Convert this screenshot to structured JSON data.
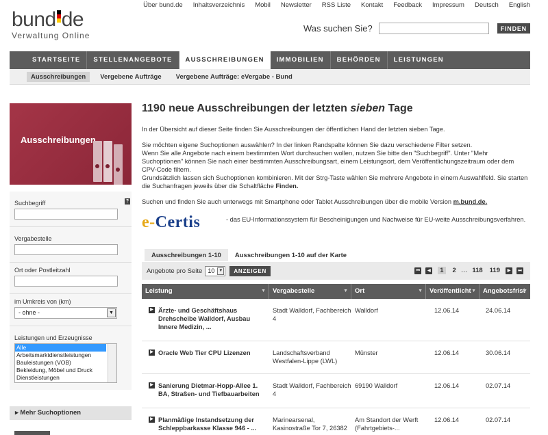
{
  "toplinks": [
    "Über bund.de",
    "Inhaltsverzeichnis",
    "Mobil",
    "Newsletter",
    "RSS Liste",
    "Kontakt",
    "Feedback",
    "Impressum",
    "Deutsch",
    "English"
  ],
  "logo": {
    "left": "bund",
    "right": "de",
    "sub": "Verwaltung Online"
  },
  "search": {
    "label": "Was suchen Sie?",
    "button": "FINDEN"
  },
  "mainnav": [
    "STARTSEITE",
    "STELLENANGEBOTE",
    "AUSSCHREIBUNGEN",
    "IMMOBILIEN",
    "BEHÖRDEN",
    "LEISTUNGEN"
  ],
  "subnav": [
    "Ausschreibungen",
    "Vergebene Aufträge",
    "Vergebene Aufträge: eVergabe - Bund"
  ],
  "sidebar": {
    "banner_title": "Ausschreibungen",
    "help": "?",
    "suchbegriff": "Suchbegriff",
    "vergabestelle": "Vergabestelle",
    "ort": "Ort oder Postleitzahl",
    "umkreis": "im Umkreis von (km)",
    "umkreis_value": "- ohne -",
    "leistungen": "Leistungen und Erzeugnisse",
    "leistungen_options": [
      "Alle",
      "Arbeitsmarktdienstleistungen",
      "Bauleistungen (VOB)",
      "Bekleidung, Möbel und Druck",
      "Dienstleistungen"
    ],
    "more": "Mehr Suchoptionen"
  },
  "main": {
    "title_pre": "1190 neue Ausschreibungen der letzten ",
    "title_em": "sieben",
    "title_post": " Tage",
    "p1": "In der Übersicht auf dieser Seite finden Sie Ausschreibungen der öffentlichen Hand der letzten sieben Tage.",
    "p2a": "Sie möchten eigene Suchoptionen auswählen? In der linken Randspalte können Sie dazu verschiedene Filter setzen.",
    "p2b": "Wenn Sie alle Angebote nach einem bestimmten Wort durchsuchen wollen, nutzen Sie bitte den \"Suchbegriff\". Unter \"Mehr Suchoptionen\" können Sie nach einer bestimmten Ausschreibungsart, einem Leistungsort, dem Veröffentlichungszeitraum oder dem CPV-Code filtern.",
    "p2c": "Grundsätzlich lassen sich Suchoptionen kombinieren. Mit der Strg-Taste wählen Sie mehrere Angebote in einem Auswahlfeld. Sie starten die Suchanfragen jeweils über die Schaltfläche ",
    "p2c_bold": "Finden.",
    "p3": "Suchen und finden Sie auch unterwegs mit Smartphone oder Tablet Ausschreibungen über die mobile Version ",
    "p3_link": "m.bund.de.",
    "ecertis_logo_e": "e-",
    "ecertis_logo_rest": "Certis",
    "ecertis_text": "- das EU-Informationssystem für Bescheinigungen und Nachweise für EU-weite Ausschreibungsverfahren."
  },
  "tabs": [
    "Ausschreibungen 1-10",
    "Ausschreibungen 1-10 auf der Karte"
  ],
  "controls": {
    "label": "Angebote pro Seite",
    "per_page": "10",
    "button": "ANZEIGEN"
  },
  "pager": {
    "current": "1",
    "next": "2",
    "dots": "…",
    "p118": "118",
    "p119": "119"
  },
  "table": {
    "headers": [
      "Leistung",
      "Vergabestelle",
      "Ort",
      "Veröffentlicht",
      "Angebotsfrist"
    ],
    "rows": [
      {
        "title": "Ärzte- und Geschäftshaus Drehscheibe Walldorf, Ausbau Innere Medizin, ...",
        "stelle": "Stadt Walldorf, Fachbereich 4",
        "ort": "Walldorf",
        "pub": "12.06.14",
        "frist": "24.06.14"
      },
      {
        "title": "Oracle Web Tier CPU Lizenzen",
        "stelle": "Landschaftsverband Westfalen-Lippe (LWL)",
        "ort": "Münster",
        "pub": "12.06.14",
        "frist": "30.06.14"
      },
      {
        "title": "Sanierung Dietmar-Hopp-Allee 1. BA, Straßen- und Tiefbauarbeiten",
        "stelle": "Stadt Walldorf, Fachbereich 4",
        "ort": "69190 Walldorf",
        "pub": "12.06.14",
        "frist": "02.07.14"
      },
      {
        "title": "Planmäßige Instandsetzung der Schleppbarkasse Klasse 946 - ...",
        "stelle": "Marinearsenal, Kasinostraße Tor 7, 26382 ...",
        "ort": "Am Standort der Werft (Fahrtgebiets-...",
        "pub": "12.06.14",
        "frist": "02.07.14"
      }
    ]
  },
  "colors": {
    "nav": "#5c5c5c",
    "banner": "#a43547",
    "flag_black": "#000000",
    "flag_red": "#dd0000",
    "flag_gold": "#ffcc00"
  }
}
